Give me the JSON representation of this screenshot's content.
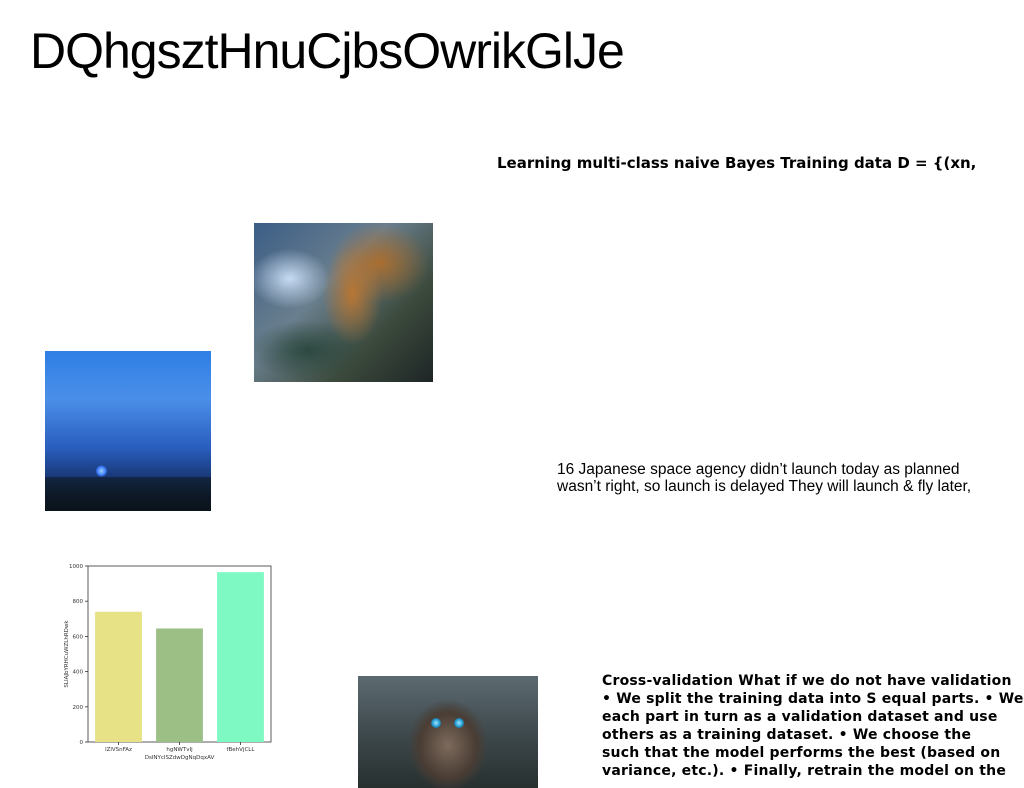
{
  "page": {
    "title": "DQhgsztHnuCjbsOwrikGlJe",
    "heading1": "Learning multi-class naive Bayes Training data D = {(xn,",
    "para1": [
      "16 Japanese space agency didn’t launch today as planned",
      "wasn’t right, so launch is delayed They will launch & fly later,"
    ],
    "para2": [
      "Cross-validation What if we do not have validation",
      "• We split the training data into S equal parts. • We",
      "each part in turn as a validation dataset and use",
      "others as a training dataset. • We choose the",
      "such that the model performs the best (based on",
      "variance, etc.). • Finally, retrain the model on the"
    ]
  },
  "chart_data": {
    "type": "bar",
    "categories": [
      "lZlVSnFAz",
      "hgNWTvIj",
      "fBehVjCLL"
    ],
    "values": [
      740,
      645,
      965
    ],
    "colors": [
      "#e6e285",
      "#9bbf85",
      "#7ef9c3"
    ],
    "xlabel": "DsINYcISZdwDgNqDqxAV",
    "ylabel": "SLIAJbYRHCuWZLhRDwk",
    "ylim": [
      0,
      1000
    ],
    "yticks": [
      0,
      200,
      400,
      600,
      800,
      1000
    ]
  }
}
